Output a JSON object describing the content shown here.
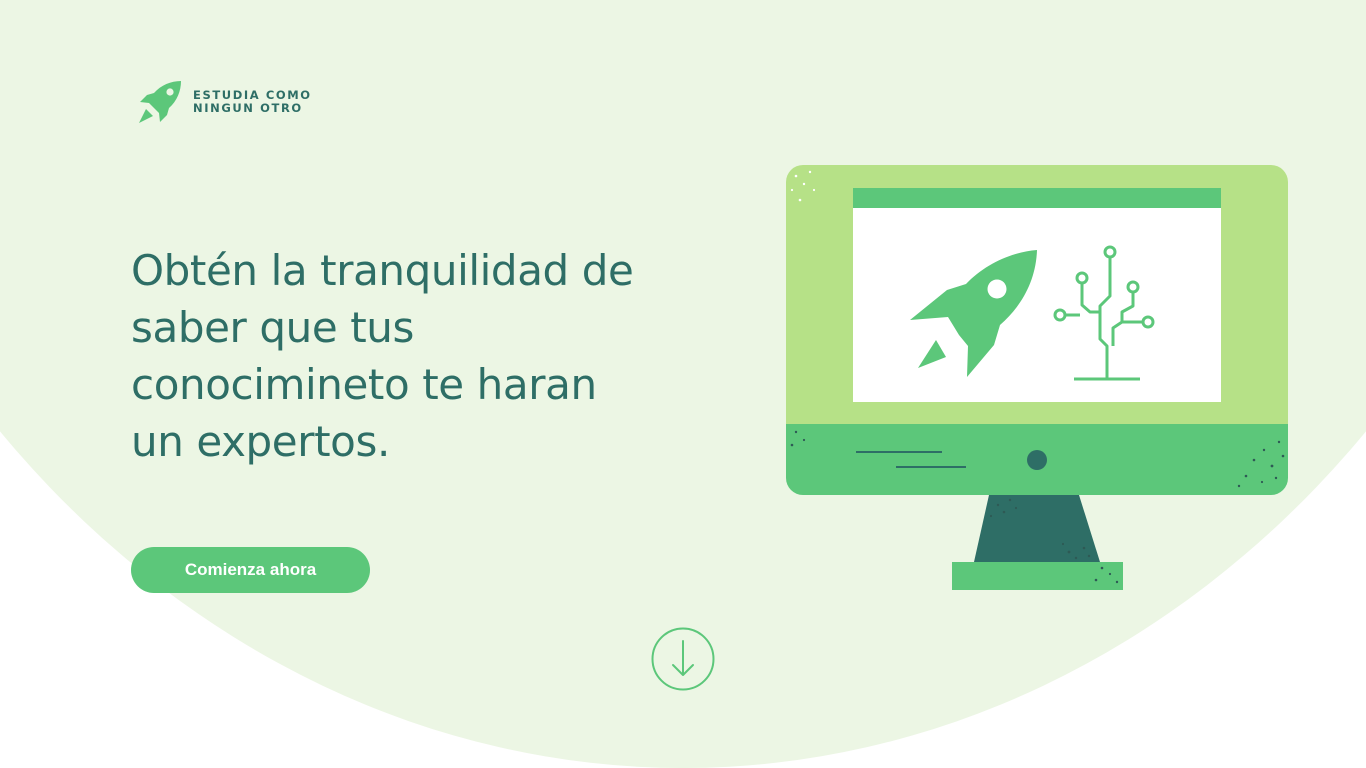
{
  "brand": {
    "line1": "ESTUDIA COMO",
    "line2": "NINGUN OTRO",
    "icon": "rocket-icon"
  },
  "hero": {
    "headline": "Obtén la tranquilidad de saber que tus conocimineto te haran un expertos.",
    "cta_label": "Comienza ahora"
  },
  "scroll_indicator": {
    "icon": "arrow-down-circle-icon"
  },
  "illustration": {
    "subject": "monitor-icon",
    "screen_icons": [
      "rocket-icon",
      "circuit-tree-icon"
    ]
  },
  "colors": {
    "background": "#ecf6e4",
    "primary_green": "#5cc77a",
    "light_green": "#b6e187",
    "dark_teal": "#2e6e66"
  }
}
